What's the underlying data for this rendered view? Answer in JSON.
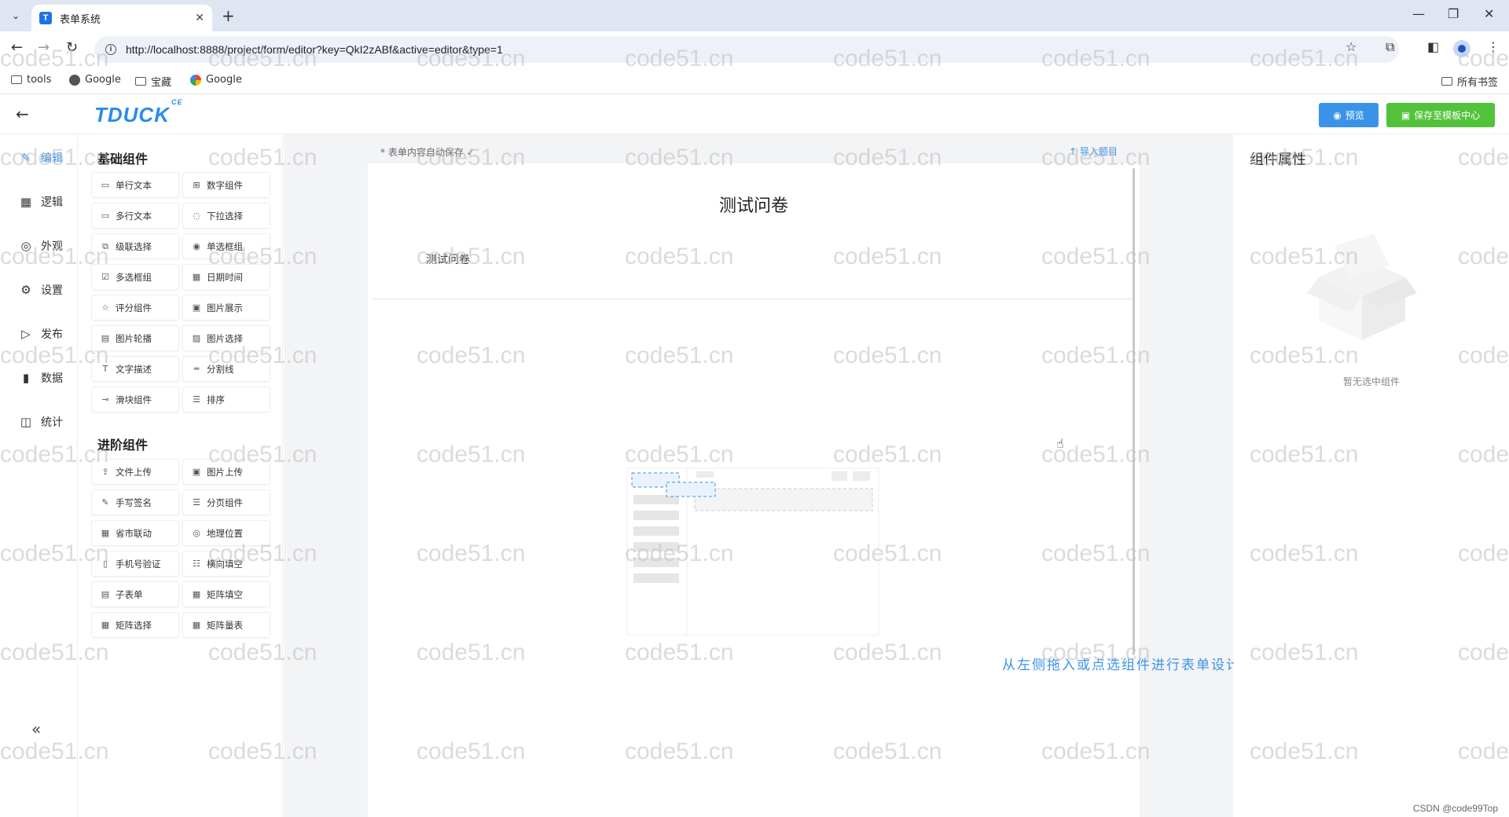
{
  "browser": {
    "tab_title": "表单系统",
    "favicon_letter": "T",
    "url": "http://localhost:8888/project/form/editor?key=QkI2zABf&active=editor&type=1",
    "bookmarks": [
      "tools",
      "Google",
      "宝藏",
      "Google"
    ],
    "all_bookmarks": "所有书签"
  },
  "header": {
    "logo": "TDUCK",
    "logo_sup": "CE",
    "preview_label": "预览",
    "save_template_label": "保存至模板中心"
  },
  "leftnav": {
    "items": [
      {
        "label": "编辑",
        "icon": "edit-icon"
      },
      {
        "label": "逻辑",
        "icon": "grid-icon"
      },
      {
        "label": "外观",
        "icon": "eye-icon"
      },
      {
        "label": "设置",
        "icon": "gear-icon"
      },
      {
        "label": "发布",
        "icon": "play-icon"
      },
      {
        "label": "数据",
        "icon": "bar-chart-icon"
      },
      {
        "label": "统计",
        "icon": "stats-icon"
      }
    ],
    "collapse": "«"
  },
  "palette": {
    "basic_title": "基础组件",
    "basic": [
      "单行文本",
      "数字组件",
      "多行文本",
      "下拉选择",
      "级联选择",
      "单选框组",
      "多选框组",
      "日期时间",
      "评分组件",
      "图片展示",
      "图片轮播",
      "图片选择",
      "文字描述",
      "分割线",
      "滑块组件",
      "排序"
    ],
    "advanced_title": "进阶组件",
    "advanced": [
      "文件上传",
      "图片上传",
      "手写签名",
      "分页组件",
      "省市联动",
      "地理位置",
      "手机号验证",
      "横向填空",
      "子表单",
      "矩阵填空",
      "矩阵选择",
      "矩阵量表"
    ]
  },
  "canvas": {
    "autosave": "表单内容自动保存 ✓",
    "import": "导入题目",
    "form_title": "测试问卷",
    "form_description": "测试问卷",
    "empty_hint": "从左侧拖入或点选组件进行表单设计"
  },
  "props": {
    "title": "组件属性",
    "empty": "暂无选中组件"
  },
  "watermark": "code51.cn",
  "credit": "CSDN @code99Top",
  "colors": {
    "primary": "#3a93e8",
    "success": "#52c23a",
    "canvas_bg": "#f3f4f6"
  }
}
